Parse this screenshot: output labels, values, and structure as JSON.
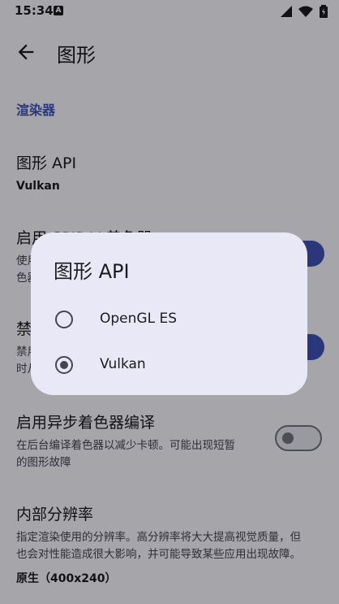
{
  "status_bar": {
    "time": "15:34",
    "notification_letter": "A"
  },
  "app_bar": {
    "title": "图形"
  },
  "settings": {
    "section_title": "渲染器",
    "graphics_api": {
      "title": "图形 API",
      "value": "Vulkan"
    },
    "spirv": {
      "title": "启用 SPIR-V 着色器",
      "sub_line1": "使用",
      "sub_line2": "色器"
    },
    "disable": {
      "title": "禁",
      "sub_line1": "禁用",
      "sub_line2": "时从"
    },
    "async_shader": {
      "title": "启用异步着色器编译",
      "subtitle_line1": "在后台编译着色器以减少卡顿。可能出现短暂",
      "subtitle_line2": "的图形故障"
    },
    "resolution": {
      "title": "内部分辨率",
      "subtitle_line1": "指定渲染使用的分辨率。高分辨率将大大提高视觉质量，但",
      "subtitle_line2": "也会对性能造成很大影响，并可能导致某些应用出现故障。",
      "value": "原生（400x240）"
    }
  },
  "dialog": {
    "title": "图形 API",
    "options": [
      {
        "label": "OpenGL ES",
        "selected": false
      },
      {
        "label": "Vulkan",
        "selected": true
      }
    ]
  },
  "colors": {
    "accent": "#3f51b5",
    "section": "#4152b6",
    "dialog_bg": "#e8e8f7"
  }
}
